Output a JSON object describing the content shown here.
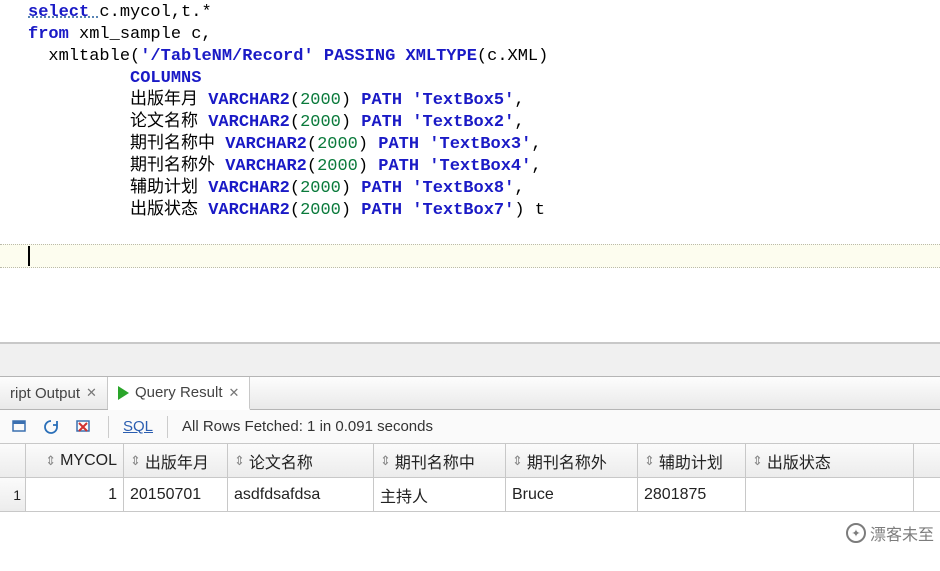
{
  "sql": {
    "lines": [
      {
        "indent": 0,
        "tokens": [
          {
            "t": "select ",
            "c": "kw underline-wave"
          },
          {
            "t": "c.mycol,t.*",
            "c": "ident"
          }
        ]
      },
      {
        "indent": 0,
        "tokens": [
          {
            "t": "from ",
            "c": "kw"
          },
          {
            "t": "xml_sample c,",
            "c": "ident"
          }
        ]
      },
      {
        "indent": 1,
        "tokens": [
          {
            "t": "xmltable",
            "c": "ident"
          },
          {
            "t": "(",
            "c": "paren"
          },
          {
            "t": "'/TableNM/Record'",
            "c": "str"
          },
          {
            "t": " ",
            "c": ""
          },
          {
            "t": "PASSING ",
            "c": "kw"
          },
          {
            "t": "XMLTYPE",
            "c": "kw"
          },
          {
            "t": "(",
            "c": "paren"
          },
          {
            "t": "c.XML",
            "c": "ident"
          },
          {
            "t": ")",
            "c": "paren"
          }
        ]
      },
      {
        "indent": 5,
        "tokens": [
          {
            "t": "COLUMNS",
            "c": "kw"
          }
        ]
      },
      {
        "indent": 5,
        "tokens": [
          {
            "t": "出版年月 ",
            "c": "ident"
          },
          {
            "t": "VARCHAR2",
            "c": "kw"
          },
          {
            "t": "(",
            "c": "paren"
          },
          {
            "t": "2000",
            "c": "green"
          },
          {
            "t": ")",
            "c": "paren"
          },
          {
            "t": " PATH ",
            "c": "kw"
          },
          {
            "t": "'TextBox5'",
            "c": "str"
          },
          {
            "t": ",",
            "c": "ident"
          }
        ]
      },
      {
        "indent": 5,
        "tokens": [
          {
            "t": "论文名称 ",
            "c": "ident"
          },
          {
            "t": "VARCHAR2",
            "c": "kw"
          },
          {
            "t": "(",
            "c": "paren"
          },
          {
            "t": "2000",
            "c": "green"
          },
          {
            "t": ")",
            "c": "paren"
          },
          {
            "t": " PATH ",
            "c": "kw"
          },
          {
            "t": "'TextBox2'",
            "c": "str"
          },
          {
            "t": ",",
            "c": "ident"
          }
        ]
      },
      {
        "indent": 5,
        "tokens": [
          {
            "t": "期刊名称中 ",
            "c": "ident"
          },
          {
            "t": "VARCHAR2",
            "c": "kw"
          },
          {
            "t": "(",
            "c": "paren"
          },
          {
            "t": "2000",
            "c": "green"
          },
          {
            "t": ")",
            "c": "paren"
          },
          {
            "t": " PATH ",
            "c": "kw"
          },
          {
            "t": "'TextBox3'",
            "c": "str"
          },
          {
            "t": ",",
            "c": "ident"
          }
        ]
      },
      {
        "indent": 5,
        "tokens": [
          {
            "t": "期刊名称外 ",
            "c": "ident"
          },
          {
            "t": "VARCHAR2",
            "c": "kw"
          },
          {
            "t": "(",
            "c": "paren"
          },
          {
            "t": "2000",
            "c": "green"
          },
          {
            "t": ")",
            "c": "paren"
          },
          {
            "t": " PATH ",
            "c": "kw"
          },
          {
            "t": "'TextBox4'",
            "c": "str"
          },
          {
            "t": ",",
            "c": "ident"
          }
        ]
      },
      {
        "indent": 5,
        "tokens": [
          {
            "t": "辅助计划 ",
            "c": "ident"
          },
          {
            "t": "VARCHAR2",
            "c": "kw"
          },
          {
            "t": "(",
            "c": "paren"
          },
          {
            "t": "2000",
            "c": "green"
          },
          {
            "t": ")",
            "c": "paren"
          },
          {
            "t": " PATH ",
            "c": "kw"
          },
          {
            "t": "'TextBox8'",
            "c": "str"
          },
          {
            "t": ",",
            "c": "ident"
          }
        ]
      },
      {
        "indent": 5,
        "tokens": [
          {
            "t": "出版状态 ",
            "c": "ident"
          },
          {
            "t": "VARCHAR2",
            "c": "kw"
          },
          {
            "t": "(",
            "c": "paren"
          },
          {
            "t": "2000",
            "c": "green"
          },
          {
            "t": ")",
            "c": "paren"
          },
          {
            "t": " PATH ",
            "c": "kw"
          },
          {
            "t": "'TextBox7'",
            "c": "str"
          },
          {
            "t": ")",
            "c": "paren"
          },
          {
            "t": " t",
            "c": "ident"
          }
        ]
      }
    ]
  },
  "tabs": {
    "script_output": "ript Output",
    "query_result": "Query Result",
    "close_glyph": "✕"
  },
  "toolbar": {
    "sql_link": "SQL",
    "status": "All Rows Fetched: 1 in 0.091 seconds"
  },
  "grid": {
    "rownum_header": "",
    "sort_glyph": "⇕",
    "columns": [
      "MYCOL",
      "出版年月",
      "论文名称",
      "期刊名称中",
      "期刊名称外",
      "辅助计划",
      "出版状态"
    ],
    "rows": [
      {
        "n": "1",
        "cells": [
          "1",
          "20150701",
          "asdfdsafdsa",
          "主持人",
          "Bruce",
          "2801875",
          ""
        ]
      }
    ]
  },
  "watermark": {
    "text": "漂客未至"
  }
}
